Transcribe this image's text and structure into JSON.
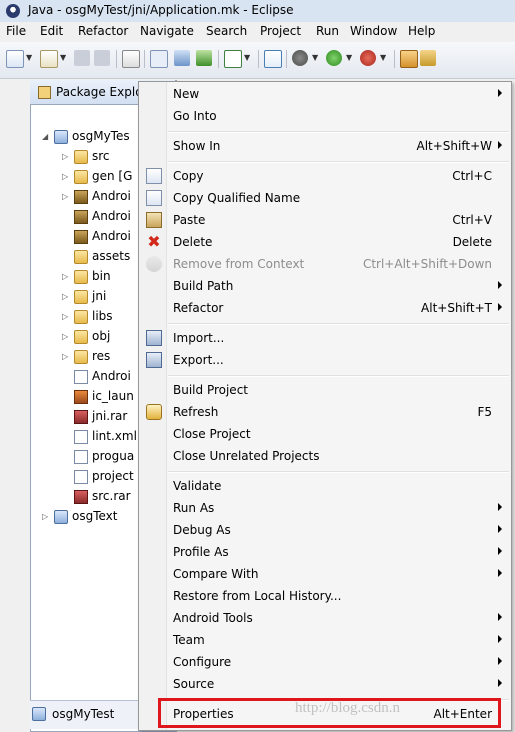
{
  "window": {
    "title": "Java - osgMyTest/jni/Application.mk - Eclipse"
  },
  "menubar": [
    "File",
    "Edit",
    "Refactor",
    "Navigate",
    "Search",
    "Project",
    "Run",
    "Window",
    "Help"
  ],
  "package_explorer": {
    "tab_label": "Package Explo",
    "tree": [
      {
        "label": "osgMyTes",
        "icon": "project-icon",
        "expanded": true,
        "level": 0
      },
      {
        "label": "src",
        "icon": "package-folder-icon",
        "level": 1
      },
      {
        "label": "gen [G",
        "icon": "package-folder-icon",
        "level": 1
      },
      {
        "label": "Androi",
        "icon": "library-icon",
        "level": 1
      },
      {
        "label": "Androi",
        "icon": "library-icon",
        "level": 1
      },
      {
        "label": "Androi",
        "icon": "library-icon",
        "level": 1
      },
      {
        "label": "assets",
        "icon": "folder-icon",
        "level": 1
      },
      {
        "label": "bin",
        "icon": "folder-icon",
        "level": 1
      },
      {
        "label": "jni",
        "icon": "folder-icon",
        "level": 1
      },
      {
        "label": "libs",
        "icon": "folder-icon",
        "level": 1
      },
      {
        "label": "obj",
        "icon": "folder-icon",
        "level": 1
      },
      {
        "label": "res",
        "icon": "folder-icon",
        "level": 1
      },
      {
        "label": "Androi",
        "icon": "xml-file-icon",
        "level": 1
      },
      {
        "label": "ic_laun",
        "icon": "image-file-icon",
        "level": 1
      },
      {
        "label": "jni.rar",
        "icon": "rar-file-icon",
        "level": 1
      },
      {
        "label": "lint.xml",
        "icon": "xml-file-icon",
        "level": 1
      },
      {
        "label": "progua",
        "icon": "text-file-icon",
        "level": 1
      },
      {
        "label": "project",
        "icon": "text-file-icon",
        "level": 1
      },
      {
        "label": "src.rar",
        "icon": "rar-file-icon",
        "level": 1
      },
      {
        "label": "osgText",
        "icon": "project-icon",
        "expanded": false,
        "level": 0
      }
    ],
    "status_label": "osgMyTest"
  },
  "context_menu": {
    "items": [
      {
        "label": "New",
        "submenu": true
      },
      {
        "label": "Go Into"
      },
      {
        "sep": true
      },
      {
        "label": "Show In",
        "shortcut": "Alt+Shift+W",
        "submenu": true
      },
      {
        "sep": true
      },
      {
        "label": "Copy",
        "shortcut": "Ctrl+C",
        "icon": "copy-icon"
      },
      {
        "label": "Copy Qualified Name",
        "icon": "copy-qualified-name-icon"
      },
      {
        "label": "Paste",
        "shortcut": "Ctrl+V",
        "icon": "paste-icon"
      },
      {
        "label": "Delete",
        "shortcut": "Delete",
        "icon": "delete-icon"
      },
      {
        "label": "Remove from Context",
        "shortcut": "Ctrl+Alt+Shift+Down",
        "disabled": true,
        "icon": "remove-context-icon"
      },
      {
        "label": "Build Path",
        "submenu": true
      },
      {
        "label": "Refactor",
        "shortcut": "Alt+Shift+T",
        "submenu": true
      },
      {
        "sep": true
      },
      {
        "label": "Import...",
        "icon": "import-icon"
      },
      {
        "label": "Export...",
        "icon": "export-icon"
      },
      {
        "sep": true
      },
      {
        "label": "Build Project"
      },
      {
        "label": "Refresh",
        "shortcut": "F5",
        "icon": "refresh-icon"
      },
      {
        "label": "Close Project"
      },
      {
        "label": "Close Unrelated Projects"
      },
      {
        "sep": true
      },
      {
        "label": "Validate"
      },
      {
        "label": "Run As",
        "submenu": true
      },
      {
        "label": "Debug As",
        "submenu": true
      },
      {
        "label": "Profile As",
        "submenu": true
      },
      {
        "label": "Compare With",
        "submenu": true
      },
      {
        "label": "Restore from Local History..."
      },
      {
        "label": "Android Tools",
        "submenu": true
      },
      {
        "label": "Team",
        "submenu": true
      },
      {
        "label": "Configure",
        "submenu": true
      },
      {
        "label": "Source",
        "submenu": true
      },
      {
        "sep": true
      },
      {
        "label": "Properties",
        "shortcut": "Alt+Enter"
      }
    ]
  },
  "watermark": "http://blog.csdn.n",
  "colors": {
    "highlight_box": "#e0161d",
    "title_bar": "#d8e4f1"
  }
}
